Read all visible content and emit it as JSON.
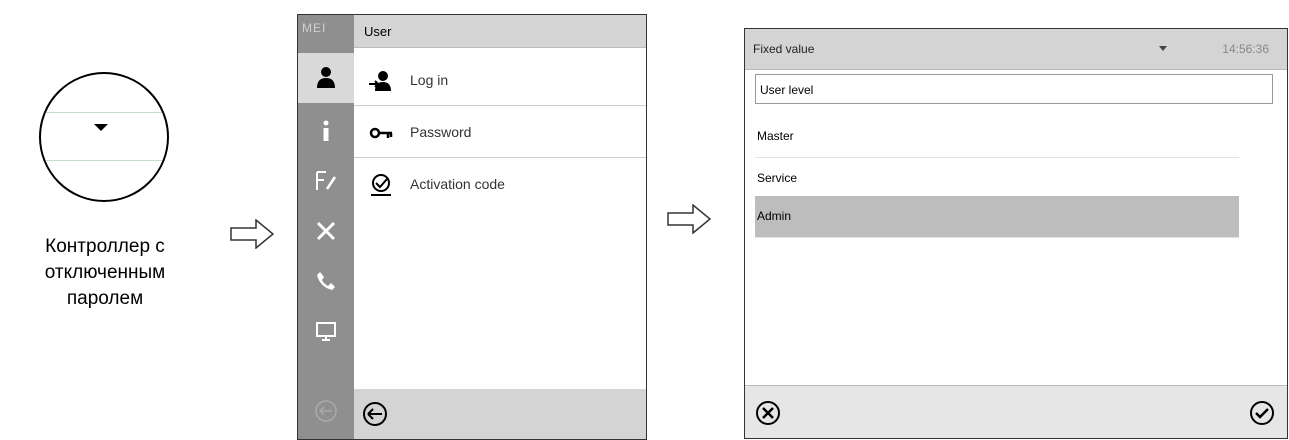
{
  "left": {
    "caption_lines": [
      "Контроллер с",
      "отключенным",
      "паролем"
    ],
    "dropdown_icon": "triangle-down-icon"
  },
  "middle": {
    "top_label": "MEI",
    "header_title": "User",
    "sidebar_icons": [
      "user-icon",
      "info-icon",
      "edit-icon",
      "tools-icon",
      "phone-icon",
      "monitor-icon"
    ],
    "menu_items": [
      {
        "label": "Log in",
        "icon": "login-icon"
      },
      {
        "label": "Password",
        "icon": "key-icon"
      },
      {
        "label": "Activation code",
        "icon": "activation-icon"
      }
    ],
    "footer_icon": "back-icon",
    "highlight_color": "#e8636b"
  },
  "right": {
    "header_title": "Fixed value",
    "time": "14:56:36",
    "list_header": "User level",
    "options": [
      "Master",
      "Service",
      "Admin"
    ],
    "selected_option": "Admin",
    "cancel_icon": "cancel-icon",
    "confirm_icon": "confirm-icon"
  }
}
